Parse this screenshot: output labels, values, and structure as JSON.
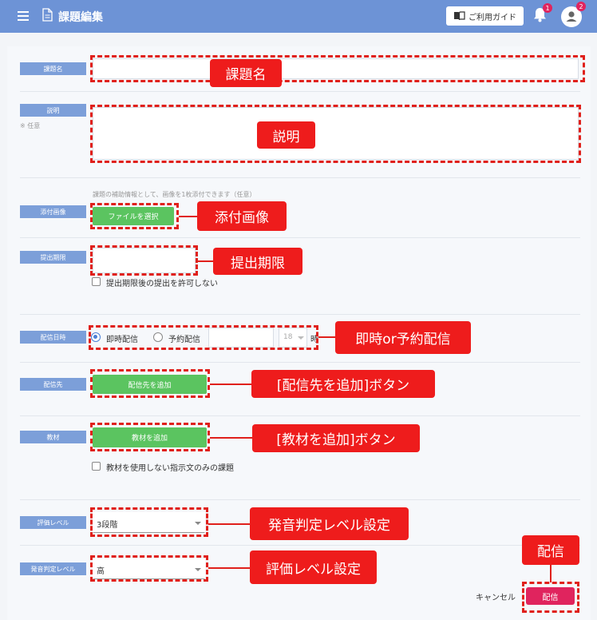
{
  "header": {
    "title": "課題編集",
    "guide_label": "ご利用ガイド",
    "notification_count": "1",
    "user_badge_count": "2",
    "bg_color": "#6d93d6"
  },
  "form": {
    "title_label": "課題名",
    "description_label": "説明",
    "description_optional": "※ 任意",
    "attachment_hint": "課題の補助情報として、画像を1枚添付できます（任意）",
    "attachment_label": "添付画像",
    "choose_file_label": "ファイルを選択",
    "deadline_label": "提出期限",
    "allow_late_label": "提出期限後の提出を許可しない",
    "delivery_time_label": "配信日時",
    "delivery_immediate": "即時配信",
    "delivery_scheduled": "予約配信",
    "hour_value": "18",
    "hour_unit": "時",
    "recipient_label": "配信先",
    "add_recipient_label": "配信先を追加",
    "material_label": "教材",
    "add_material_label": "教材を追加",
    "no_material_label": "教材を使用しない指示文のみの課題",
    "eval_level_label": "評価レベル",
    "eval_level_value": "3段階",
    "pron_level_label": "発音判定レベル",
    "pron_level_value": "高",
    "cancel_label": "キャンセル",
    "submit_label": "配信"
  },
  "annotations": {
    "title": "課題名",
    "description": "説明",
    "attachment": "添付画像",
    "deadline": "提出期限",
    "delivery": "即時or予約配信",
    "recipient": "[配信先を追加]ボタン",
    "material": "[教材を追加]ボタン",
    "eval_level": "発音判定レベル設定",
    "pron_level": "評価レベル設定",
    "submit": "配信"
  },
  "icons": {
    "menu": "hamburger-icon",
    "document": "document-icon",
    "book": "book-icon",
    "bell": "bell-icon",
    "user": "user-icon",
    "dropdown": "chevron-down-icon"
  },
  "colors": {
    "accent": "#7c9fd9",
    "green": "#5bc460",
    "submit": "#e0245e",
    "annotation": "#ee1c1c"
  }
}
